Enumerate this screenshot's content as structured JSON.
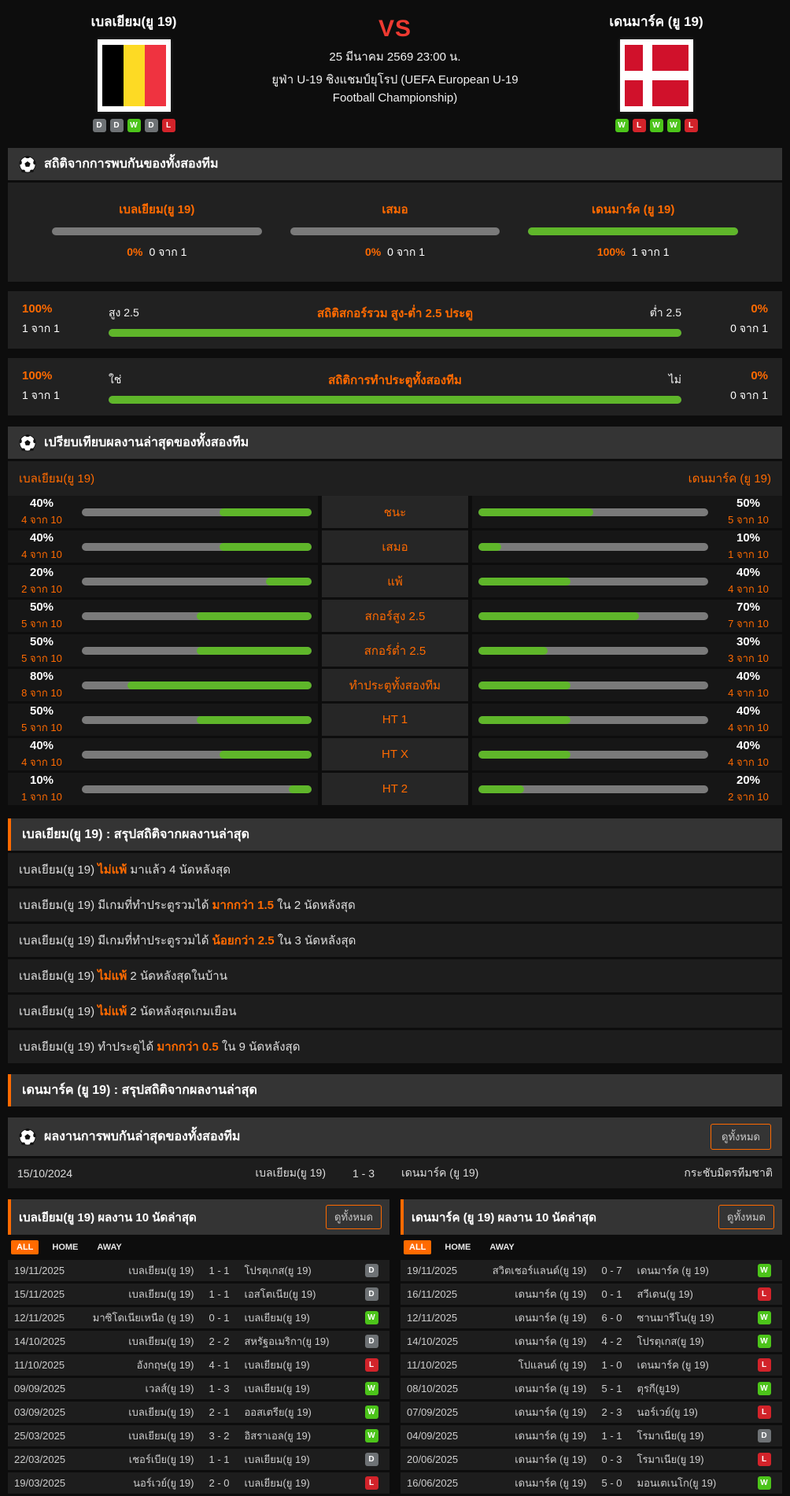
{
  "header": {
    "home": {
      "name": "เบลเยียม(ยู 19)",
      "form": [
        "D",
        "D",
        "W",
        "D",
        "L"
      ]
    },
    "away": {
      "name": "เดนมาร์ค (ยู 19)",
      "form": [
        "W",
        "L",
        "W",
        "W",
        "L"
      ]
    },
    "vs": "VS",
    "datetime": "25 มีนาคม 2569 23:00 น.",
    "competition": "ยูฟ่า U-19 ชิงแชมป์ยุโรป (UEFA European U-19 Football Championship)"
  },
  "colors": {
    "accent": "#ff6a00",
    "green": "#5fb62a",
    "gray_bar": "#7a7a7a",
    "win": "#4cc41a",
    "draw": "#6e7275",
    "lose": "#d2232a",
    "vs_red": "#ee3a31"
  },
  "h2h_stats": {
    "title": "สถิติจากการพบกันของทั้งสองทีม",
    "win_bars": [
      {
        "label": "เบลเยียม(ยู 19)",
        "pct": "0%",
        "pct_val": 0,
        "count": "0 จาก 1"
      },
      {
        "label": "เสมอ",
        "pct": "0%",
        "pct_val": 0,
        "count": "0 จาก 1"
      },
      {
        "label": "เดนมาร์ค (ยู 19)",
        "pct": "100%",
        "pct_val": 100,
        "count": "1 จาก 1"
      }
    ],
    "over_under": {
      "left_pct": "100%",
      "left_count": "1 จาก 1",
      "left_label": "สูง 2.5",
      "title": "สถิติสกอร์รวม สูง-ต่ำ 2.5 ประตู",
      "right_label": "ต่ำ 2.5",
      "right_pct": "0%",
      "right_count": "0 จาก 1",
      "bar_val": 100
    },
    "btts": {
      "left_pct": "100%",
      "left_count": "1 จาก 1",
      "left_label": "ใช่",
      "title": "สถิติการทำประตูทั้งสองทีม",
      "right_label": "ไม่",
      "right_pct": "0%",
      "right_count": "0 จาก 1",
      "bar_val": 100
    }
  },
  "comparison": {
    "title": "เปรียบเทียบผลงานล่าสุดของทั้งสองทีม",
    "home_name": "เบลเยียม(ยู 19)",
    "away_name": "เดนมาร์ค (ยู 19)",
    "rows": [
      {
        "label": "ชนะ",
        "home_pct": "40%",
        "home_val": 40,
        "home_count": "4 จาก 10",
        "away_pct": "50%",
        "away_val": 50,
        "away_count": "5 จาก 10"
      },
      {
        "label": "เสมอ",
        "home_pct": "40%",
        "home_val": 40,
        "home_count": "4 จาก 10",
        "away_pct": "10%",
        "away_val": 10,
        "away_count": "1 จาก 10"
      },
      {
        "label": "แพ้",
        "home_pct": "20%",
        "home_val": 20,
        "home_count": "2 จาก 10",
        "away_pct": "40%",
        "away_val": 40,
        "away_count": "4 จาก 10"
      },
      {
        "label": "สกอร์สูง 2.5",
        "home_pct": "50%",
        "home_val": 50,
        "home_count": "5 จาก 10",
        "away_pct": "70%",
        "away_val": 70,
        "away_count": "7 จาก 10"
      },
      {
        "label": "สกอร์ต่ำ 2.5",
        "home_pct": "50%",
        "home_val": 50,
        "home_count": "5 จาก 10",
        "away_pct": "30%",
        "away_val": 30,
        "away_count": "3 จาก 10"
      },
      {
        "label": "ทำประตูทั้งสองทีม",
        "home_pct": "80%",
        "home_val": 80,
        "home_count": "8 จาก 10",
        "away_pct": "40%",
        "away_val": 40,
        "away_count": "4 จาก 10"
      },
      {
        "label": "HT 1",
        "home_pct": "50%",
        "home_val": 50,
        "home_count": "5 จาก 10",
        "away_pct": "40%",
        "away_val": 40,
        "away_count": "4 จาก 10"
      },
      {
        "label": "HT X",
        "home_pct": "40%",
        "home_val": 40,
        "home_count": "4 จาก 10",
        "away_pct": "40%",
        "away_val": 40,
        "away_count": "4 จาก 10"
      },
      {
        "label": "HT 2",
        "home_pct": "10%",
        "home_val": 10,
        "home_count": "1 จาก 10",
        "away_pct": "20%",
        "away_val": 20,
        "away_count": "2 จาก 10"
      }
    ]
  },
  "home_summary": {
    "title": "เบลเยียม(ยู 19) : สรุปสถิติจากผลงานล่าสุด",
    "items": [
      {
        "pre": "เบลเยียม(ยู 19) ",
        "mark": "ไม่แพ้",
        "post": " มาแล้ว 4 นัดหลังสุด"
      },
      {
        "pre": "เบลเยียม(ยู 19) มีเกมที่ทำประตูรวมได้ ",
        "mark": "มากกว่า 1.5",
        "post": " ใน 2 นัดหลังสุด"
      },
      {
        "pre": "เบลเยียม(ยู 19) มีเกมที่ทำประตูรวมได้ ",
        "mark": "น้อยกว่า 2.5",
        "post": " ใน 3 นัดหลังสุด"
      },
      {
        "pre": "เบลเยียม(ยู 19) ",
        "mark": "ไม่แพ้",
        "post": " 2 นัดหลังสุดในบ้าน"
      },
      {
        "pre": "เบลเยียม(ยู 19) ",
        "mark": "ไม่แพ้",
        "post": " 2 นัดหลังสุดเกมเยือน"
      },
      {
        "pre": "เบลเยียม(ยู 19) ทำประตูได้ ",
        "mark": "มากกว่า 0.5",
        "post": " ใน 9 นัดหลังสุด"
      }
    ]
  },
  "away_summary": {
    "title": "เดนมาร์ค (ยู 19) : สรุปสถิติจากผลงานล่าสุด"
  },
  "h2h_results": {
    "title": "ผลงานการพบกันล่าสุดของทั้งสองทีม",
    "view_all": "ดูทั้งหมด",
    "rows": [
      {
        "date": "15/10/2024",
        "home": "เบลเยียม(ยู 19)",
        "score": "1 - 3",
        "away": "เดนมาร์ค (ยู 19)",
        "competition": "กระชับมิตรทีมชาติ"
      }
    ]
  },
  "recent_home": {
    "title": "เบลเยียม(ยู 19) ผลงาน 10 นัดล่าสุด",
    "view_all": "ดูทั้งหมด",
    "tabs": [
      "ALL",
      "HOME",
      "AWAY"
    ],
    "rows": [
      {
        "date": "19/11/2025",
        "home": "เบลเยียม(ยู 19)",
        "score": "1 - 1",
        "away": "โปรตุเกส(ยู 19)",
        "result": "D"
      },
      {
        "date": "15/11/2025",
        "home": "เบลเยียม(ยู 19)",
        "score": "1 - 1",
        "away": "เอสโตเนีย(ยู 19)",
        "result": "D"
      },
      {
        "date": "12/11/2025",
        "home": "มาซิโดเนียเหนือ (ยู 19)",
        "score": "0 - 1",
        "away": "เบลเยียม(ยู 19)",
        "result": "W"
      },
      {
        "date": "14/10/2025",
        "home": "เบลเยียม(ยู 19)",
        "score": "2 - 2",
        "away": "สหรัฐอเมริกา(ยู 19)",
        "result": "D"
      },
      {
        "date": "11/10/2025",
        "home": "อังกฤษ(ยู 19)",
        "score": "4 - 1",
        "away": "เบลเยียม(ยู 19)",
        "result": "L"
      },
      {
        "date": "09/09/2025",
        "home": "เวลส์(ยู 19)",
        "score": "1 - 3",
        "away": "เบลเยียม(ยู 19)",
        "result": "W"
      },
      {
        "date": "03/09/2025",
        "home": "เบลเยียม(ยู 19)",
        "score": "2 - 1",
        "away": "ออสเตรีย(ยู 19)",
        "result": "W"
      },
      {
        "date": "25/03/2025",
        "home": "เบลเยียม(ยู 19)",
        "score": "3 - 2",
        "away": "อิสราเอล(ยู 19)",
        "result": "W"
      },
      {
        "date": "22/03/2025",
        "home": "เชอร์เบีย(ยู 19)",
        "score": "1 - 1",
        "away": "เบลเยียม(ยู 19)",
        "result": "D"
      },
      {
        "date": "19/03/2025",
        "home": "นอร์เวย์(ยู 19)",
        "score": "2 - 0",
        "away": "เบลเยียม(ยู 19)",
        "result": "L"
      }
    ]
  },
  "recent_away": {
    "title": "เดนมาร์ค (ยู 19) ผลงาน 10 นัดล่าสุด",
    "view_all": "ดูทั้งหมด",
    "tabs": [
      "ALL",
      "HOME",
      "AWAY"
    ],
    "rows": [
      {
        "date": "19/11/2025",
        "home": "สวิตเชอร์แลนด์(ยู 19)",
        "score": "0 - 7",
        "away": "เดนมาร์ค (ยู 19)",
        "result": "W"
      },
      {
        "date": "16/11/2025",
        "home": "เดนมาร์ค (ยู 19)",
        "score": "0 - 1",
        "away": "สวีเดน(ยู 19)",
        "result": "L"
      },
      {
        "date": "12/11/2025",
        "home": "เดนมาร์ค (ยู 19)",
        "score": "6 - 0",
        "away": "ซานมารีโน(ยู 19)",
        "result": "W"
      },
      {
        "date": "14/10/2025",
        "home": "เดนมาร์ค (ยู 19)",
        "score": "4 - 2",
        "away": "โปรตุเกส(ยู 19)",
        "result": "W"
      },
      {
        "date": "11/10/2025",
        "home": "โปแลนด์ (ยู 19)",
        "score": "1 - 0",
        "away": "เดนมาร์ค (ยู 19)",
        "result": "L"
      },
      {
        "date": "08/10/2025",
        "home": "เดนมาร์ค (ยู 19)",
        "score": "5 - 1",
        "away": "ตุรกี(ยู19)",
        "result": "W"
      },
      {
        "date": "07/09/2025",
        "home": "เดนมาร์ค (ยู 19)",
        "score": "2 - 3",
        "away": "นอร์เวย์(ยู 19)",
        "result": "L"
      },
      {
        "date": "04/09/2025",
        "home": "เดนมาร์ค (ยู 19)",
        "score": "1 - 1",
        "away": "โรมาเนีย(ยู 19)",
        "result": "D"
      },
      {
        "date": "20/06/2025",
        "home": "เดนมาร์ค (ยู 19)",
        "score": "0 - 3",
        "away": "โรมาเนีย(ยู 19)",
        "result": "L"
      },
      {
        "date": "16/06/2025",
        "home": "เดนมาร์ค (ยู 19)",
        "score": "5 - 0",
        "away": "มอนเตเนโก(ยู 19)",
        "result": "W"
      }
    ]
  }
}
